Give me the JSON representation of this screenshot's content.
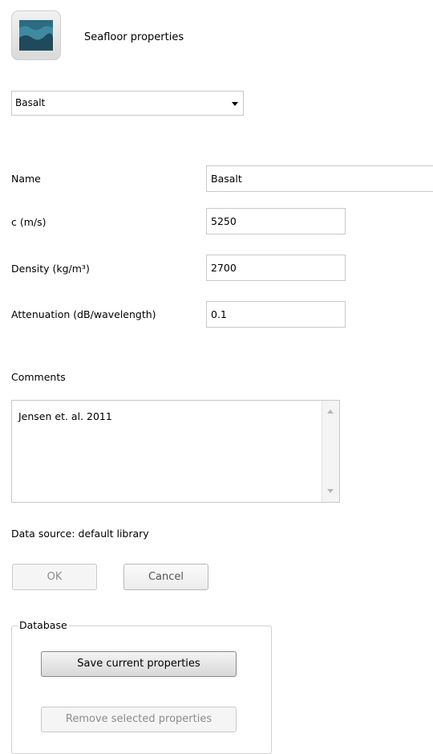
{
  "header": {
    "title": "Seafloor properties",
    "icon": "seafloor-icon"
  },
  "material_select": {
    "selected": "Basalt"
  },
  "fields": {
    "name": {
      "label": "Name",
      "value": "Basalt"
    },
    "sound_speed": {
      "label": "c (m/s)",
      "value": "5250"
    },
    "density": {
      "label": "Density (kg/m³)",
      "value": "2700"
    },
    "attenuation": {
      "label": "Attenuation (dB/wavelength)",
      "value": "0.1"
    }
  },
  "comments": {
    "label": "Comments",
    "value": "Jensen et. al. 2011"
  },
  "data_source": "Data source: default library",
  "buttons": {
    "ok": "OK",
    "cancel": "Cancel"
  },
  "database": {
    "label": "Database",
    "save_label": "Save current properties",
    "remove_label": "Remove selected properties"
  },
  "colors": {
    "icon_water_dark": "#1f4a5c",
    "icon_water_light": "#3f8aa0"
  }
}
